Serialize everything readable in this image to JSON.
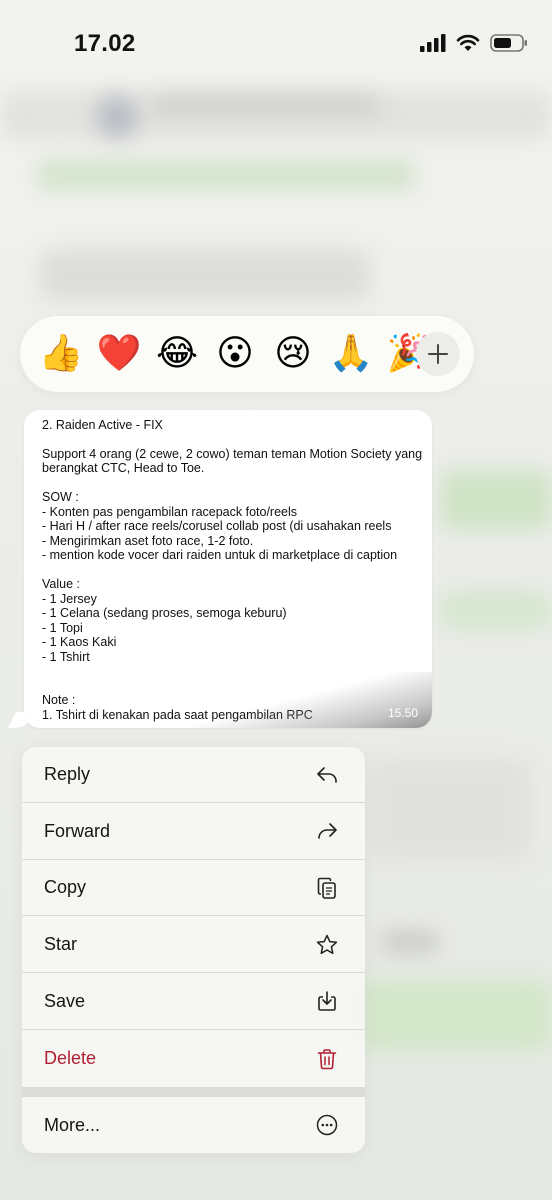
{
  "status_bar": {
    "time": "17.02"
  },
  "reactions": {
    "emojis": [
      "👍",
      "❤️",
      "😂",
      "😮",
      "😢",
      "🙏",
      "🎉"
    ],
    "more_icon": "plus-icon"
  },
  "message": {
    "title": "2. Raiden Active - FIX",
    "lines": [
      "Support 4 orang (2 cewe, 2 cowo) teman teman Motion Society yang",
      "berangkat CTC, Head to Toe.",
      "",
      "SOW :",
      "- Konten pas pengambilan racepack foto/reels",
      "- Hari H / after race reels/corusel collab post (di usahakan reels",
      "- Mengirimkan aset foto race, 1-2 foto.",
      "- mention kode vocer dari raiden untuk di marketplace di caption",
      "",
      "Value :",
      "- 1 Jersey",
      "- 1 Celana (sedang proses, semoga keburu)",
      "- 1 Topi",
      "- 1 Kaos Kaki",
      "- 1 Tshirt",
      "",
      "",
      "Note :",
      "1. Tshirt di kenakan pada saat pengambilan RPC"
    ],
    "time": "15.50"
  },
  "menu": {
    "items": [
      {
        "label": "Reply",
        "icon": "reply-icon"
      },
      {
        "label": "Forward",
        "icon": "forward-icon"
      },
      {
        "label": "Copy",
        "icon": "copy-icon"
      },
      {
        "label": "Star",
        "icon": "star-icon"
      },
      {
        "label": "Save",
        "icon": "save-icon"
      },
      {
        "label": "Delete",
        "icon": "trash-icon"
      }
    ],
    "more": {
      "label": "More...",
      "icon": "ellipsis-circle-icon"
    }
  },
  "colors": {
    "danger": "#b22033",
    "bubble": "#ffffff",
    "menu_bg": "#f6f6f3"
  }
}
